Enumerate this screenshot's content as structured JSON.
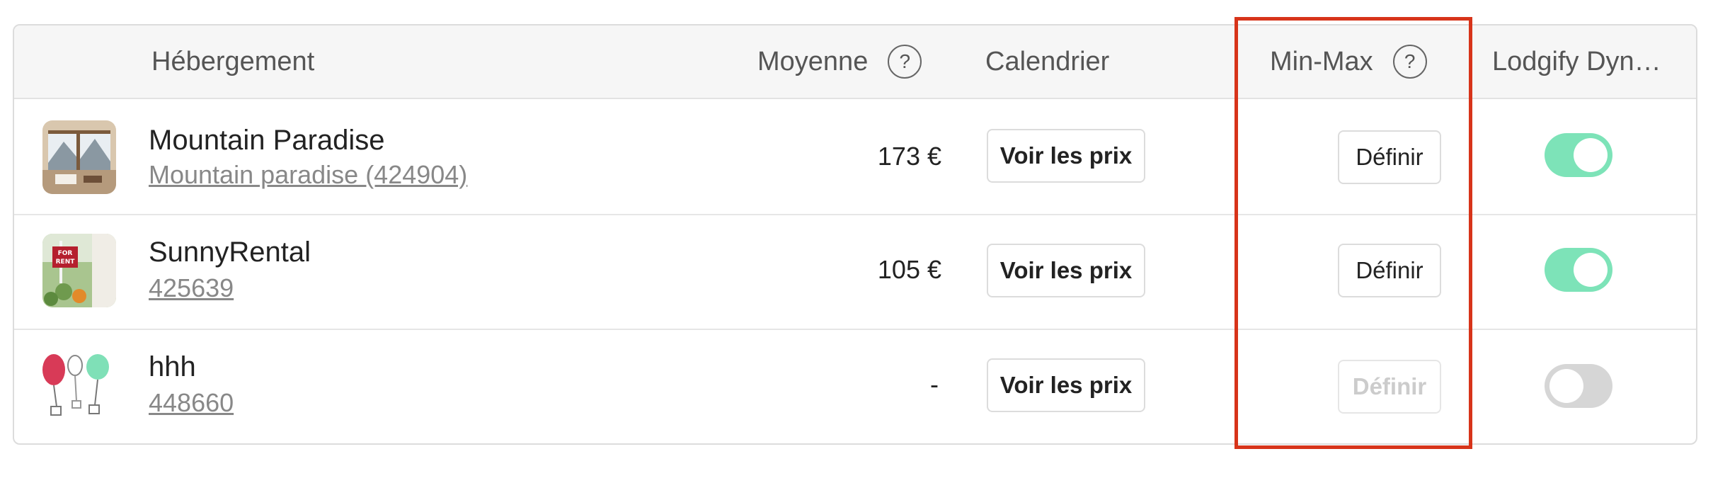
{
  "header": {
    "col_accommodation": "Hébergement",
    "col_average": "Moyenne",
    "col_calendar": "Calendrier",
    "col_minmax": "Min-Max",
    "col_dynamic": "Lodgify Dyn…",
    "help_glyph": "?"
  },
  "rows": [
    {
      "name": "Mountain Paradise",
      "sub": "Mountain paradise (424904)",
      "price": "173 €",
      "prices_button": "Voir les prix",
      "define_button": "Définir",
      "define_enabled": true,
      "toggle_on": true,
      "thumb_icon": "mountain-house-thumbnail"
    },
    {
      "name": "SunnyRental",
      "sub": "425639",
      "price": "105 €",
      "prices_button": "Voir les prix",
      "define_button": "Définir",
      "define_enabled": true,
      "toggle_on": true,
      "thumb_icon": "for-rent-sign-thumbnail"
    },
    {
      "name": "hhh",
      "sub": "448660",
      "price": "-",
      "prices_button": "Voir les prix",
      "define_button": "Définir",
      "define_enabled": false,
      "toggle_on": false,
      "thumb_icon": "balloons-thumbnail"
    }
  ],
  "colors": {
    "toggle_on": "#7de3b8",
    "toggle_off": "#d6d6d6",
    "highlight": "#d7341a",
    "header_bg": "#f6f6f6"
  }
}
